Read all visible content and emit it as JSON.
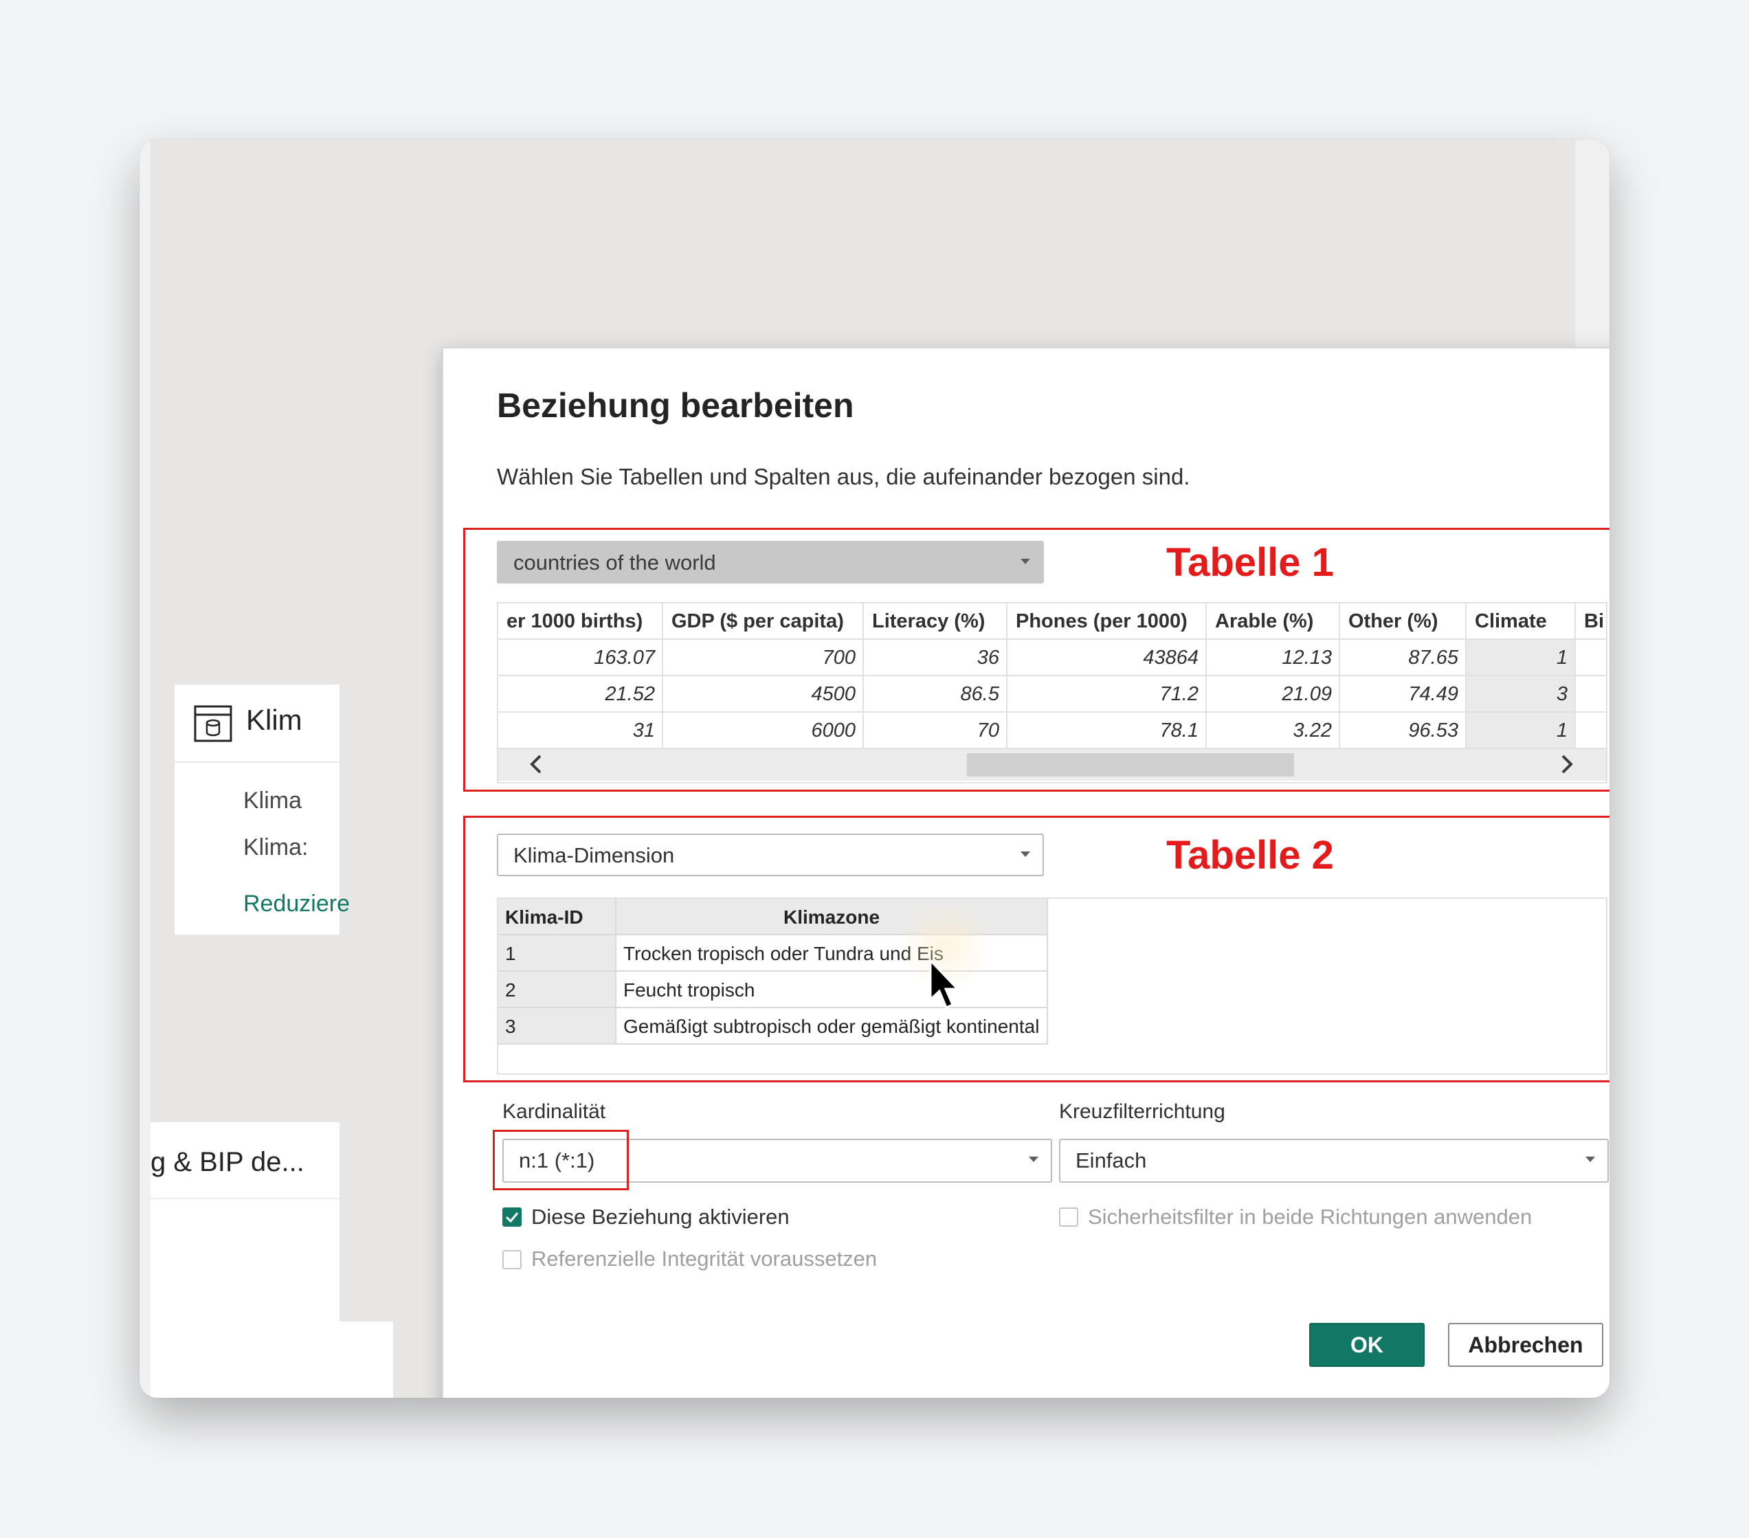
{
  "dialog": {
    "title": "Beziehung bearbeiten",
    "subtitle": "Wählen Sie Tabellen und Spalten aus, die aufeinander bezogen sind."
  },
  "annotations": {
    "table1_label": "Tabelle 1",
    "table2_label": "Tabelle 2",
    "color": "#e02020"
  },
  "table1": {
    "selected": "countries of the world",
    "columns": [
      "er 1000 births)",
      "GDP ($ per capita)",
      "Literacy (%)",
      "Phones (per 1000)",
      "Arable (%)",
      "Other (%)",
      "Climate",
      "Bi"
    ],
    "rows": [
      [
        "163.07",
        "700",
        "36",
        "43864",
        "12.13",
        "87.65",
        "1",
        ""
      ],
      [
        "21.52",
        "4500",
        "86.5",
        "71.2",
        "21.09",
        "74.49",
        "3",
        ""
      ],
      [
        "31",
        "6000",
        "70",
        "78.1",
        "3.22",
        "96.53",
        "1",
        ""
      ]
    ],
    "scroll_left_icon": "chevron-left-icon",
    "scroll_right_icon": "chevron-right-icon"
  },
  "table2": {
    "selected": "Klima-Dimension",
    "columns": [
      "Klima-ID",
      "Klimazone"
    ],
    "rows": [
      [
        "1",
        "Trocken tropisch oder Tundra und Eis"
      ],
      [
        "2",
        "Feucht tropisch"
      ],
      [
        "3",
        "Gemäßigt subtropisch oder gemäßigt kontinental"
      ]
    ]
  },
  "cardinality": {
    "label": "Kardinalität",
    "value": "n:1 (*:1)"
  },
  "crossfilter": {
    "label": "Kreuzfilterrichtung",
    "value": "Einfach"
  },
  "options": {
    "activate": {
      "label": "Diese Beziehung aktivieren",
      "checked": true
    },
    "security_filter": {
      "label": "Sicherheitsfilter in beide Richtungen anwenden",
      "checked": false
    },
    "referential": {
      "label": "Referenzielle Integrität voraussetzen",
      "checked": false
    }
  },
  "buttons": {
    "ok": "OK",
    "cancel": "Abbrechen"
  },
  "background": {
    "card_title": "Klim",
    "card_fields": [
      "Klima",
      "Klima:"
    ],
    "card_link": "Reduziere",
    "card2_title": "g & BIP de...",
    "accent": "#117865"
  }
}
